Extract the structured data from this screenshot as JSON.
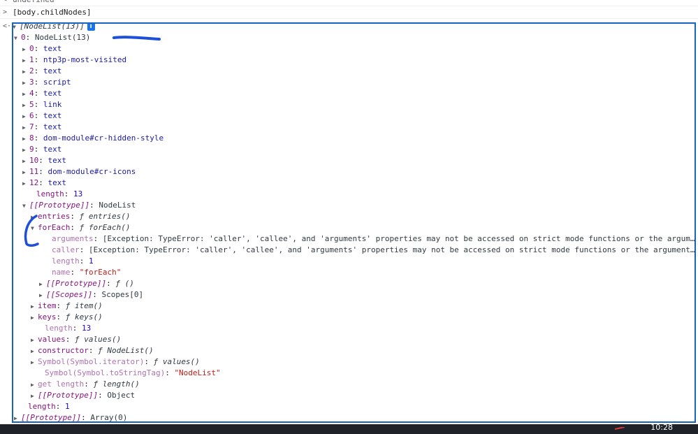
{
  "console": {
    "prev_output": "undefined",
    "input": "[body.childNodes]",
    "result_summary": "[NodeList(13)]",
    "info_icon_label": "i",
    "tree": [
      {
        "tri": "down",
        "k": "0",
        "kc": "k-idx",
        "sep": ": ",
        "v": "NodeList(13)",
        "vc": "v-obj"
      },
      {
        "tri": "right",
        "k": "0",
        "kc": "k-idx",
        "sep": ": ",
        "v": "text",
        "vc": "v"
      },
      {
        "tri": "right",
        "k": "1",
        "kc": "k-idx",
        "sep": ": ",
        "v": "ntp3p-most-visited",
        "vc": "v"
      },
      {
        "tri": "right",
        "k": "2",
        "kc": "k-idx",
        "sep": ": ",
        "v": "text",
        "vc": "v"
      },
      {
        "tri": "right",
        "k": "3",
        "kc": "k-idx",
        "sep": ": ",
        "v": "script",
        "vc": "v"
      },
      {
        "tri": "right",
        "k": "4",
        "kc": "k-idx",
        "sep": ": ",
        "v": "text",
        "vc": "v"
      },
      {
        "tri": "right",
        "k": "5",
        "kc": "k-idx",
        "sep": ": ",
        "v": "link",
        "vc": "v"
      },
      {
        "tri": "right",
        "k": "6",
        "kc": "k-idx",
        "sep": ": ",
        "v": "text",
        "vc": "v"
      },
      {
        "tri": "right",
        "k": "7",
        "kc": "k-idx",
        "sep": ": ",
        "v": "text",
        "vc": "v"
      },
      {
        "tri": "right",
        "k": "8",
        "kc": "k-idx",
        "sep": ": ",
        "v": "dom-module#cr-hidden-style",
        "vc": "v"
      },
      {
        "tri": "right",
        "k": "9",
        "kc": "k-idx",
        "sep": ": ",
        "v": "text",
        "vc": "v"
      },
      {
        "tri": "right",
        "k": "10",
        "kc": "k-idx",
        "sep": ": ",
        "v": "text",
        "vc": "v"
      },
      {
        "tri": "right",
        "k": "11",
        "kc": "k-idx",
        "sep": ": ",
        "v": "dom-module#cr-icons",
        "vc": "v"
      },
      {
        "tri": "right",
        "k": "12",
        "kc": "k-idx",
        "sep": ": ",
        "v": "text",
        "vc": "v"
      },
      {
        "tri": "none",
        "k": "length",
        "kc": "k",
        "sep": ": ",
        "v": "13",
        "vc": "v-num"
      },
      {
        "tri": "down",
        "k": "[[Prototype]]",
        "kc": "k-italic",
        "sep": ": ",
        "v": "NodeList",
        "vc": "v-obj"
      },
      {
        "tri": "right",
        "k": "entries",
        "kc": "k",
        "sep": ": ",
        "v": "ƒ entries()",
        "vc": "v-fn"
      },
      {
        "tri": "down",
        "k": "forEach",
        "kc": "k",
        "sep": ": ",
        "v": "ƒ forEach()",
        "vc": "v-fn"
      },
      {
        "tri": "none",
        "k": "arguments",
        "kc": "k-dim",
        "sep": ": ",
        "v": "[Exception: TypeError: 'caller', 'callee', and 'arguments' properties may not be accessed on strict mode functions or the argum…",
        "vc": "v-obj"
      },
      {
        "tri": "none",
        "k": "caller",
        "kc": "k-dim",
        "sep": ": ",
        "v": "[Exception: TypeError: 'caller', 'callee', and 'arguments' properties may not be accessed on strict mode functions or the argument…",
        "vc": "v-obj"
      },
      {
        "tri": "none",
        "k": "length",
        "kc": "k-dim",
        "sep": ": ",
        "v": "1",
        "vc": "v-num"
      },
      {
        "tri": "none",
        "k": "name",
        "kc": "k-dim",
        "sep": ": ",
        "v": "\"forEach\"",
        "vc": "v-str"
      },
      {
        "tri": "right",
        "k": "[[Prototype]]",
        "kc": "k-italic",
        "sep": ": ",
        "v": "ƒ ()",
        "vc": "v-fn"
      },
      {
        "tri": "right",
        "k": "[[Scopes]]",
        "kc": "k-italic",
        "sep": ": ",
        "v": "Scopes[0]",
        "vc": "v-obj"
      },
      {
        "tri": "right",
        "k": "item",
        "kc": "k",
        "sep": ": ",
        "v": "ƒ item()",
        "vc": "v-fn"
      },
      {
        "tri": "right",
        "k": "keys",
        "kc": "k",
        "sep": ": ",
        "v": "ƒ keys()",
        "vc": "v-fn"
      },
      {
        "tri": "none",
        "k": "length",
        "kc": "k-dim",
        "sep": ": ",
        "v": "13",
        "vc": "v-num"
      },
      {
        "tri": "right",
        "k": "values",
        "kc": "k",
        "sep": ": ",
        "v": "ƒ values()",
        "vc": "v-fn"
      },
      {
        "tri": "right",
        "k": "constructor",
        "kc": "k",
        "sep": ": ",
        "v": "ƒ NodeList()",
        "vc": "v-fn"
      },
      {
        "tri": "right",
        "k": "Symbol(Symbol.iterator)",
        "kc": "k-dim",
        "sep": ": ",
        "v": "ƒ values()",
        "vc": "v-fn"
      },
      {
        "tri": "none",
        "k": "Symbol(Symbol.toStringTag)",
        "kc": "k-dim",
        "sep": ": ",
        "v": "\"NodeList\"",
        "vc": "v-str"
      },
      {
        "tri": "right",
        "k": "get length",
        "kc": "k-dim",
        "sep": ": ",
        "v": "ƒ length()",
        "vc": "v-fn"
      },
      {
        "tri": "right",
        "k": "[[Prototype]]",
        "kc": "k-italic",
        "sep": ": ",
        "v": "Object",
        "vc": "v-obj"
      },
      {
        "tri": "none",
        "k": "length",
        "kc": "k",
        "sep": ": ",
        "v": "1",
        "vc": "v-num"
      },
      {
        "tri": "right",
        "k": "[[Prototype]]",
        "kc": "k-italic",
        "sep": ": ",
        "v": "Array(0)",
        "vc": "v-obj"
      }
    ]
  },
  "taskbar": {
    "clock": "10:28"
  },
  "colors": {
    "frame": "#1565c0",
    "ink": "#1e4fd8",
    "taskbar": "#1f2329"
  }
}
